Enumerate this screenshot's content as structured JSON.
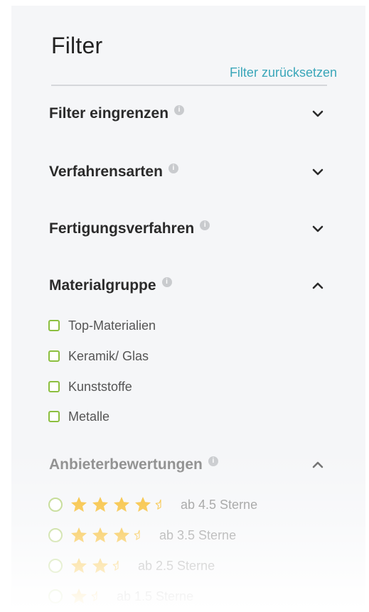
{
  "filter": {
    "title": "Filter",
    "reset_label": "Filter zurücksetzen"
  },
  "sections": [
    {
      "label": "Filter eingrenzen",
      "expanded": false,
      "info_icon": "info-icon",
      "chevron_icon": "chevron-down-icon"
    },
    {
      "label": "Verfahrensarten",
      "expanded": false,
      "info_icon": "info-icon",
      "chevron_icon": "chevron-down-icon"
    },
    {
      "label": "Fertigungsverfahren",
      "expanded": false,
      "info_icon": "info-icon",
      "chevron_icon": "chevron-down-icon"
    },
    {
      "label": "Materialgruppe",
      "expanded": true,
      "info_icon": "info-icon",
      "chevron_icon": "chevron-up-icon"
    },
    {
      "label": "Anbieterbewertungen",
      "expanded": true,
      "info_icon": "info-icon",
      "chevron_icon": "chevron-up-icon"
    }
  ],
  "material_options": [
    {
      "label": "Top-Materialien",
      "checked": false
    },
    {
      "label": "Keramik/ Glas",
      "checked": false
    },
    {
      "label": "Kunststoffe",
      "checked": false
    },
    {
      "label": "Metalle",
      "checked": false
    }
  ],
  "rating_options": [
    {
      "label": "ab 4.5 Sterne",
      "stars": 4.5,
      "selected": false
    },
    {
      "label": "ab 3.5 Sterne",
      "stars": 3.5,
      "selected": false
    },
    {
      "label": "ab 2.5 Sterne",
      "stars": 2.5,
      "selected": false
    },
    {
      "label": "ab 1.5 Sterne",
      "stars": 1.5,
      "selected": false
    }
  ],
  "colors": {
    "accent_link": "#3aa6b9",
    "checkbox_border": "#8cbf3f",
    "star_fill": "#f5b821",
    "panel_bg": "#f5f6f8"
  }
}
